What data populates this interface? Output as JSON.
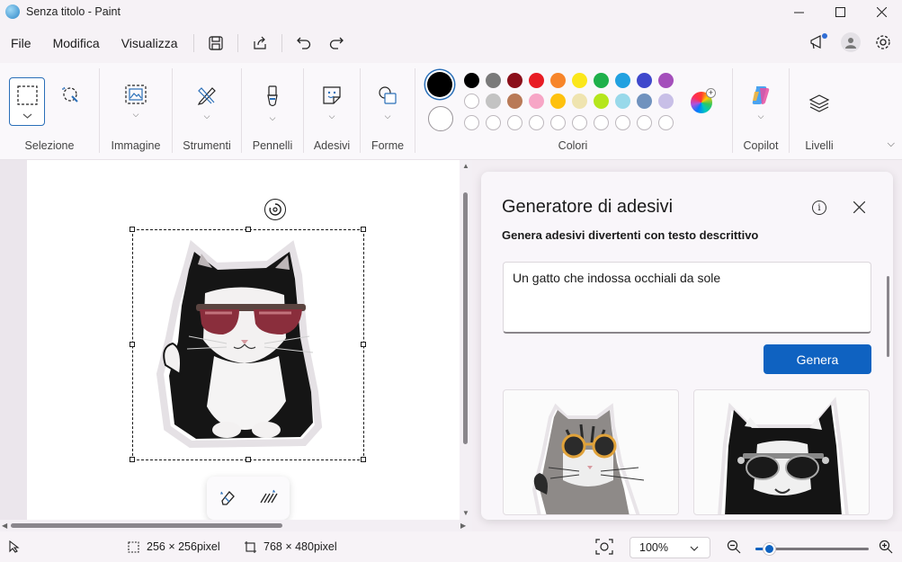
{
  "window": {
    "title": "Senza titolo - Paint",
    "app_icon": "paint-palette-icon"
  },
  "menu": {
    "items": [
      "File",
      "Modifica",
      "Visualizza"
    ]
  },
  "quick_actions": [
    "save-icon",
    "share-icon",
    "undo-icon",
    "redo-icon"
  ],
  "ribbon": {
    "groups": {
      "selection": "Selezione",
      "image": "Immagine",
      "tools": "Strumenti",
      "brushes": "Pennelli",
      "stickers": "Adesivi",
      "shapes": "Forme",
      "colors": "Colori",
      "copilot": "Copilot",
      "layers": "Livelli"
    },
    "primary_color": "#000000",
    "secondary_color": "#ffffff",
    "palette_row1": [
      "#000000",
      "#7a7a7a",
      "#8b0f1a",
      "#e81c24",
      "#f7852a",
      "#fbe71b",
      "#1fb04b",
      "#22a1e0",
      "#3f48cc",
      "#a44fbb"
    ],
    "palette_row2": [
      "#ffffff",
      "#c3c3c3",
      "#b97a57",
      "#f7a6c6",
      "#fec10f",
      "#efe4b0",
      "#b5e61d",
      "#99d9ea",
      "#7092be",
      "#c8bfe7"
    ]
  },
  "sticker_panel": {
    "title": "Generatore di adesivi",
    "subtitle": "Genera adesivi divertenti con testo descrittivo",
    "prompt_value": "Un gatto che indossa occhiali da sole",
    "generate_label": "Genera"
  },
  "status": {
    "selection_size": "256 × 256pixel",
    "canvas_size": "768 × 480pixel",
    "zoom": "100%",
    "zoom_level": 0.12
  }
}
